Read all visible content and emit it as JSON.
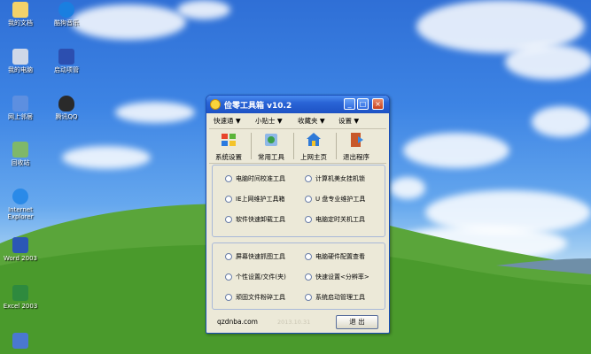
{
  "desktop_icons": [
    {
      "label": "我的文档",
      "icon": "my-documents-icon",
      "color": "#f3d26a"
    },
    {
      "label": "酷狗音乐",
      "icon": "kugou-music-icon",
      "color": "#1a7fe0"
    },
    {
      "label": "我的电脑",
      "icon": "my-computer-icon",
      "color": "#cfd8e8"
    },
    {
      "label": "启动项管",
      "icon": "startup-manager-icon",
      "color": "#2c4fb0"
    },
    {
      "label": "网上邻居",
      "icon": "network-icon",
      "color": "#5d8fe0"
    },
    {
      "label": "腾讯QQ",
      "icon": "qq-penguin-icon",
      "color": "#2a2a2a"
    },
    {
      "label": "回收站",
      "icon": "recycle-bin-icon",
      "color": "#7fb86a"
    },
    {
      "label": "Internet Explorer",
      "icon": "internet-explorer-icon",
      "color": "#2a8ae8"
    },
    {
      "label": "Word 2003",
      "icon": "word-2003-icon",
      "color": "#2b57b5"
    },
    {
      "label": "Excel 2003",
      "icon": "excel-2003-icon",
      "color": "#2e8a3e"
    }
  ],
  "window": {
    "title": "俭零工具箱 v10.2",
    "min": "_",
    "max": "□",
    "close": "×",
    "menus": [
      "快速通 ▼",
      "小贴士 ▼",
      "收藏夹 ▼",
      "设置 ▼"
    ],
    "toolbar": [
      {
        "label": "系统设置",
        "icon": "windows-flag-icon"
      },
      {
        "label": "常用工具",
        "icon": "tools-icon"
      },
      {
        "label": "上网主页",
        "icon": "home-icon"
      },
      {
        "label": "退出程序",
        "icon": "exit-door-icon"
      }
    ],
    "group1": [
      "电脑时间校准工具",
      "计算机美女挂机锁",
      "IE上网维护工具箱",
      "U 盘专业维护工具",
      "软件快速卸载工具",
      "电脑定时关机工具"
    ],
    "group2": [
      "屏幕快速抓图工具",
      "电脑硬件配置查看",
      "个性设置/文件(夹)",
      "快速设置<分辨率>",
      "顽固文件粉碎工具",
      "系统启动管理工具"
    ],
    "site": "qzdnba.com",
    "date": "2013.10.31",
    "exit": "退  出"
  }
}
